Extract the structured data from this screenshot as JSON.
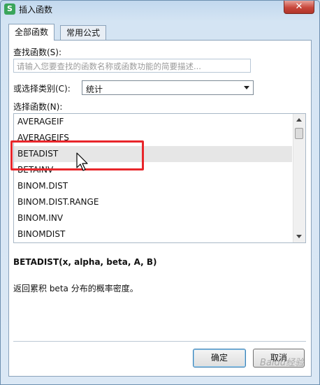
{
  "window": {
    "title": "插入函数",
    "app_icon_letter": "S",
    "close_symbol": "✕"
  },
  "tabs": [
    {
      "label": "全部函数",
      "active": true
    },
    {
      "label": "常用公式",
      "active": false
    }
  ],
  "search": {
    "label": "查找函数(S):",
    "placeholder": "请输入您要查找的函数名称或函数功能的简要描述..."
  },
  "category": {
    "label": "或选择类别(C):",
    "value": "统计"
  },
  "function_list": {
    "label": "选择函数(N):",
    "items": [
      {
        "name": "AVERAGEIF",
        "selected": false
      },
      {
        "name": "AVERAGEIFS",
        "selected": false
      },
      {
        "name": "BETADIST",
        "selected": true
      },
      {
        "name": "BETAINV",
        "selected": false
      },
      {
        "name": "BINOM.DIST",
        "selected": false
      },
      {
        "name": "BINOM.DIST.RANGE",
        "selected": false
      },
      {
        "name": "BINOM.INV",
        "selected": false
      },
      {
        "name": "BINOMDIST",
        "selected": false
      }
    ]
  },
  "syntax": "BETADIST(x, alpha, beta, A, B)",
  "description": "返回累积 beta 分布的概率密度。",
  "buttons": {
    "ok": "确定",
    "cancel": "取消"
  },
  "watermark": "Baidu经验",
  "colors": {
    "highlight_box": "#e8262b",
    "selected_row": "#e6e6e6",
    "app_icon": "#3aa55b"
  }
}
